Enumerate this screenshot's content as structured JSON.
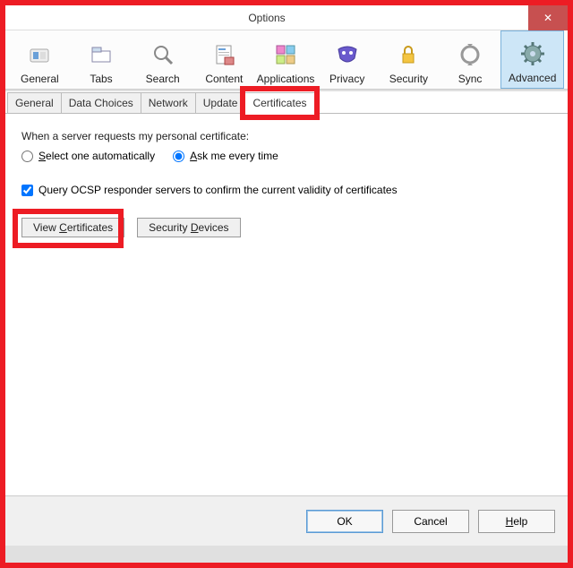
{
  "window": {
    "title": "Options"
  },
  "categories": [
    {
      "label": "General"
    },
    {
      "label": "Tabs"
    },
    {
      "label": "Search"
    },
    {
      "label": "Content"
    },
    {
      "label": "Applications"
    },
    {
      "label": "Privacy"
    },
    {
      "label": "Security"
    },
    {
      "label": "Sync"
    },
    {
      "label": "Advanced"
    }
  ],
  "subtabs": [
    {
      "label": "General"
    },
    {
      "label": "Data Choices"
    },
    {
      "label": "Network"
    },
    {
      "label": "Update"
    },
    {
      "label": "Certificates"
    }
  ],
  "cert_panel": {
    "prompt_label": "When a server requests my personal certificate:",
    "radio_auto": "Select one automatically",
    "radio_ask": "Ask me every time",
    "ocsp_label": "Query OCSP responder servers to confirm the current validity of certificates",
    "view_btn": "View Certificates",
    "devices_btn": "Security Devices"
  },
  "buttons": {
    "ok": "OK",
    "cancel": "Cancel",
    "help": "Help"
  }
}
